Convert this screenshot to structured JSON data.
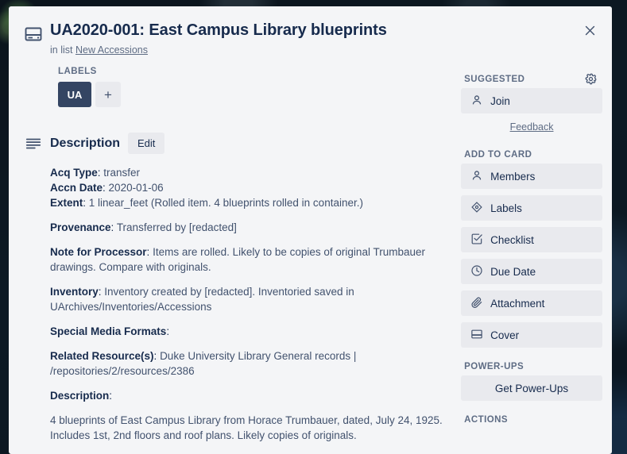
{
  "card": {
    "title": "UA2020-001: East Campus Library blueprints",
    "in_list_prefix": "in list",
    "list_name": "New Accessions",
    "header_icon": "card-cover-icon",
    "close_icon": "close-icon"
  },
  "labels": {
    "heading": "LABELS",
    "chips": [
      {
        "text": "UA",
        "color": "#344563"
      }
    ],
    "add_label": "+"
  },
  "description": {
    "heading": "Description",
    "edit_label": "Edit",
    "icon": "description-lines-icon",
    "fields": [
      {
        "label": "Acq Type",
        "value": "transfer"
      },
      {
        "label": "Accn Date",
        "value": "2020-01-06"
      },
      {
        "label": "Extent",
        "value": "1 linear_feet (Rolled item. 4 blueprints rolled in container.)"
      },
      {
        "label": "Provenance",
        "value": "Transferred by [redacted]"
      },
      {
        "label": "Note for Processor",
        "value": "Items are rolled. Likely to be copies of original Trumbauer drawings. Compare with originals."
      },
      {
        "label": "Inventory",
        "value": "Inventory created by [redacted]. Inventoried saved in UArchives/Inventories/Accessions"
      },
      {
        "label": "Special Media Formats",
        "value": ""
      },
      {
        "label": "Related Resource(s)",
        "value": "Duke University Library General records | /repositories/2/resources/2386"
      },
      {
        "label": "Description",
        "value": ""
      }
    ],
    "body_text": "4 blueprints of East Campus Library from Horace Trumbauer, dated, July 24, 1925. Includes 1st, 2nd floors and roof plans. Likely copies of originals."
  },
  "sidebar": {
    "suggested": {
      "heading": "SUGGESTED",
      "gear_icon": "gear-icon",
      "items": [
        {
          "label": "Join",
          "icon": "person-icon"
        }
      ],
      "feedback_label": "Feedback"
    },
    "add_to_card": {
      "heading": "ADD TO CARD",
      "items": [
        {
          "label": "Members",
          "icon": "person-icon"
        },
        {
          "label": "Labels",
          "icon": "label-tag-icon"
        },
        {
          "label": "Checklist",
          "icon": "checkbox-icon"
        },
        {
          "label": "Due Date",
          "icon": "clock-icon"
        },
        {
          "label": "Attachment",
          "icon": "paperclip-icon"
        },
        {
          "label": "Cover",
          "icon": "cover-icon"
        }
      ]
    },
    "power_ups": {
      "heading": "POWER-UPS",
      "button_label": "Get Power-Ups"
    },
    "actions": {
      "heading": "ACTIONS"
    }
  },
  "colors": {
    "modal_bg": "#f4f5f7",
    "text_primary": "#172b4d",
    "text_subtle": "#5e6c84",
    "button_bg": "#e9eaee",
    "label_chip": "#344563"
  }
}
